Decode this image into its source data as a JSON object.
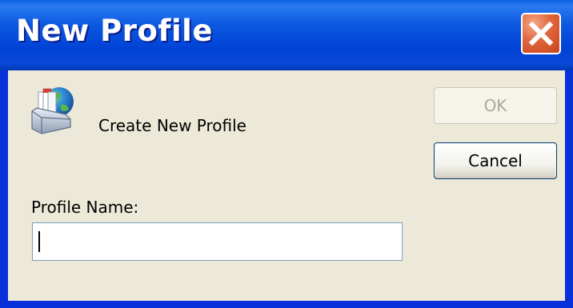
{
  "window": {
    "title": "New Profile",
    "close_icon": "close-icon"
  },
  "header": {
    "icon": "profile-mail-globe-icon",
    "message": "Create New Profile"
  },
  "buttons": {
    "ok_label": "OK",
    "cancel_label": "Cancel"
  },
  "form": {
    "label": "Profile Name:",
    "value": "",
    "placeholder": ""
  },
  "colors": {
    "titlebar": "#0a4ad8",
    "close_button": "#e0663d",
    "dialog_background": "#ece9d8",
    "input_border": "#7f9db9",
    "disabled_text": "#aca899"
  }
}
